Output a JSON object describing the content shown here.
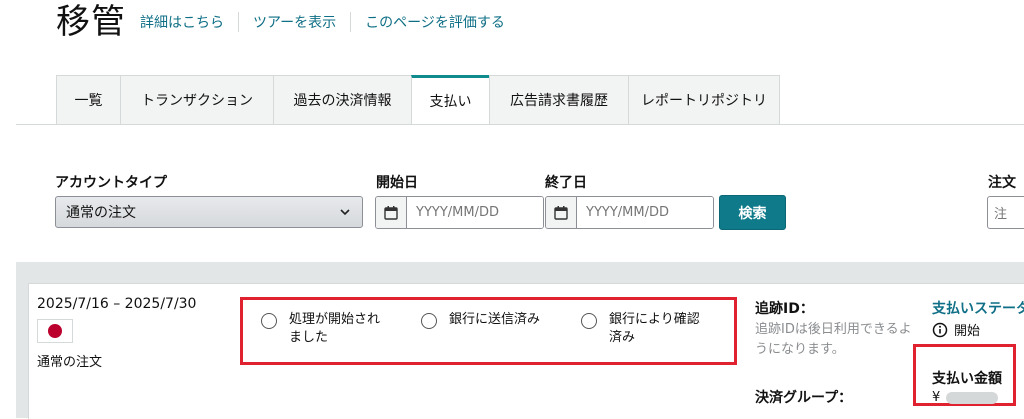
{
  "header": {
    "title": "移管",
    "links": [
      "詳細はこちら",
      "ツアーを表示",
      "このページを評価する"
    ]
  },
  "tabs": [
    {
      "label": "一覧",
      "active": false
    },
    {
      "label": "トランザクション",
      "active": false
    },
    {
      "label": "過去の決済情報",
      "active": false
    },
    {
      "label": "支払い",
      "active": true
    },
    {
      "label": "広告請求書履歴",
      "active": false
    },
    {
      "label": "レポートリポジトリ",
      "active": false
    }
  ],
  "filters": {
    "account_type_label": "アカウントタイプ",
    "account_type_value": "通常の注文",
    "start_date_label": "開始日",
    "start_date_placeholder": "YYYY/MM/DD",
    "end_date_label": "終了日",
    "end_date_placeholder": "YYYY/MM/DD",
    "search_label": "検索",
    "cut_label": "注文",
    "cut_input_text": "注"
  },
  "payment": {
    "period": "2025/7/16 – 2025/7/30",
    "account": "通常の注文",
    "statuses": [
      {
        "label_line1": "処理が開始され",
        "label_line2": "ました"
      },
      {
        "label_line1": "銀行に送信済み",
        "label_line2": ""
      },
      {
        "label_line1": "銀行により確認",
        "label_line2": "済み"
      }
    ],
    "tracking_label": "追跡ID：",
    "tracking_note": "追跡IDは後日利用できるようになります。",
    "group_label": "決済グループ：",
    "pay_status_label": "支払いステータス",
    "pay_status_value": "開始",
    "amount_label": "支払い金額",
    "amount_currency": "¥"
  },
  "colors": {
    "accent": "#0f8b8d",
    "link": "#0f6f86",
    "highlight": "#e0212f",
    "flag_red": "#bc002d"
  }
}
